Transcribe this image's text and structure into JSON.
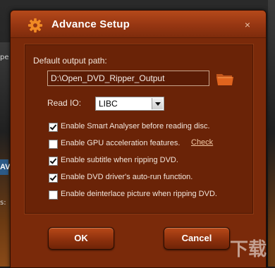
{
  "dialog": {
    "title": "Advance Setup",
    "close_symbol": "×",
    "gear_icon": "gear-icon"
  },
  "output": {
    "label": "Default output path:",
    "path_value": "D:\\Open_DVD_Ripper_Output",
    "folder_icon": "folder-icon"
  },
  "read_io": {
    "label": "Read IO:",
    "selected": "LIBC"
  },
  "options": [
    {
      "label": "Enable Smart Analyser before reading disc.",
      "checked": true
    },
    {
      "label": "Enable GPU acceleration features.",
      "checked": false
    },
    {
      "label": "Enable subtitle when ripping DVD.",
      "checked": true
    },
    {
      "label": "Enable DVD driver's auto-run function.",
      "checked": true
    },
    {
      "label": "Enable deinterlace picture when ripping DVD.",
      "checked": false
    }
  ],
  "check_link": "Check",
  "buttons": {
    "ok": "OK",
    "cancel": "Cancel"
  },
  "background": {
    "left_text_1": "pe",
    "left_text_2": "AV",
    "left_text_3": "s:"
  },
  "watermark": "下载",
  "colors": {
    "dialog_bg": "#7a2a0a",
    "titlebar": "#963612",
    "accent_orange": "#e8741e"
  }
}
